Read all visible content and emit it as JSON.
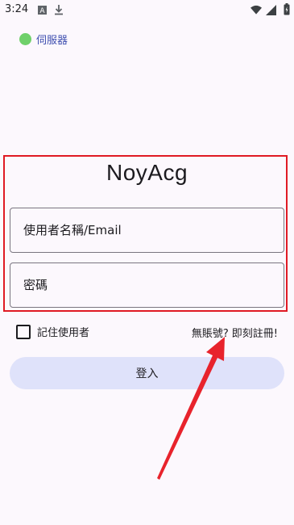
{
  "status_bar": {
    "time": "3:24",
    "icons": [
      "a-notification-icon",
      "download-icon",
      "wifi-icon",
      "signal-icon",
      "battery-icon"
    ]
  },
  "server": {
    "label": "伺服器",
    "status_color": "#6fd06a"
  },
  "app": {
    "title": "NoyAcg"
  },
  "form": {
    "username_placeholder": "使用者名稱/Email",
    "password_placeholder": "密碼",
    "remember_label": "記住使用者",
    "no_account_text": "無賬號?",
    "register_link": "即刻註冊!",
    "login_button": "登入"
  },
  "colors": {
    "accent": "#3f4fb0",
    "button_bg": "#dfe2fa",
    "highlight_red": "#e01a24"
  }
}
